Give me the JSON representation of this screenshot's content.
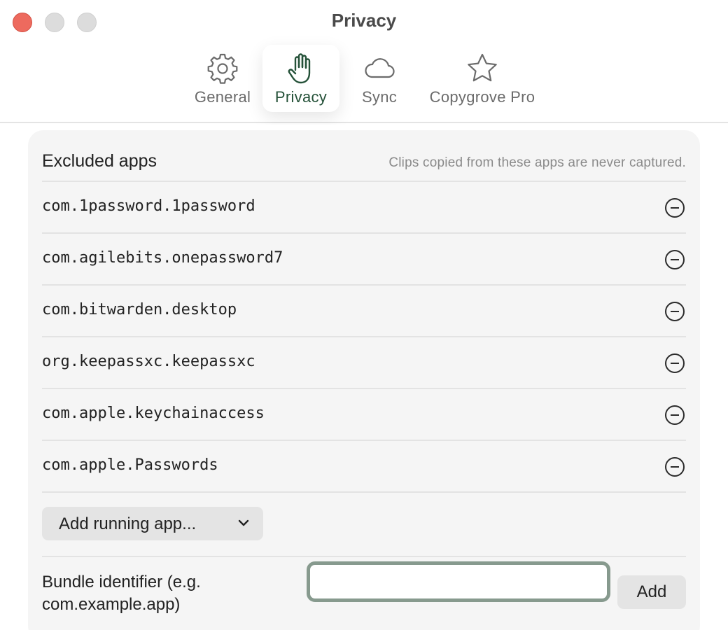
{
  "window": {
    "title": "Privacy"
  },
  "tabs": [
    {
      "label": "General",
      "icon": "gear-icon"
    },
    {
      "label": "Privacy",
      "icon": "hand-icon",
      "active": true
    },
    {
      "label": "Sync",
      "icon": "cloud-icon"
    },
    {
      "label": "Copygrove Pro",
      "icon": "star-icon"
    }
  ],
  "excluded": {
    "title": "Excluded apps",
    "hint": "Clips copied from these apps are never captured.",
    "apps": [
      "com.1password.1password",
      "com.agilebits.onepassword7",
      "com.bitwarden.desktop",
      "org.keepassxc.keepassxc",
      "com.apple.keychainaccess",
      "com.apple.Passwords"
    ],
    "add_running_label": "Add running app...",
    "bundle_label": "Bundle identifier (e.g. com.example.app)",
    "bundle_value": "",
    "add_label": "Add"
  },
  "colors": {
    "accent": "#245138",
    "close": "#ed6a5e",
    "panel": "#f5f5f5",
    "field_border": "#879a8e"
  }
}
